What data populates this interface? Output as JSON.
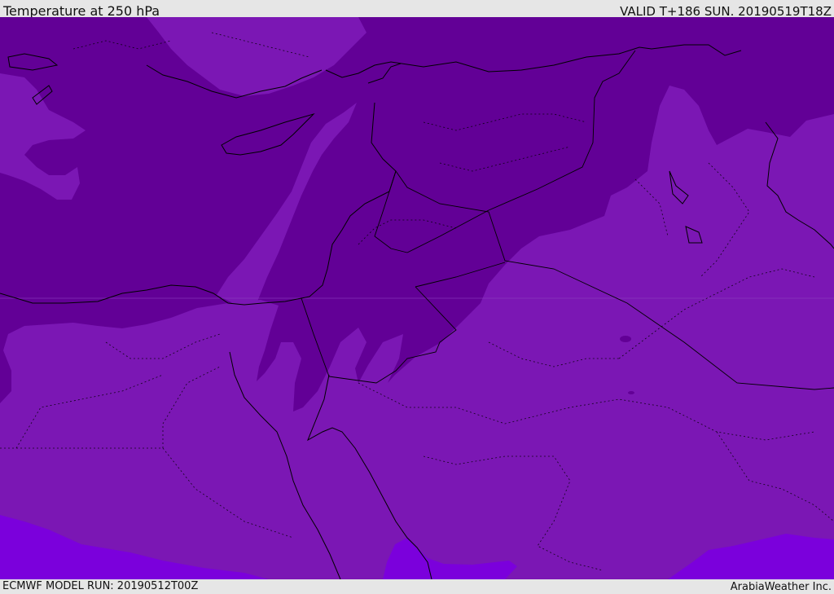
{
  "header": {
    "title": "Temperature at 250 hPa",
    "valid_time": "VALID T+186 SUN. 20190519T18Z"
  },
  "footer": {
    "model_run": "ECMWF MODEL RUN: 20190512T00Z",
    "provider": "ArabiaWeather Inc."
  },
  "map": {
    "region": "Eastern Mediterranean / Levant / Arabia",
    "colors": {
      "coldest_band": "#620096",
      "cold_band": "#7b17b4",
      "warm_band": "#7b00dc",
      "coastline": "#000000",
      "border": "#000000"
    }
  }
}
